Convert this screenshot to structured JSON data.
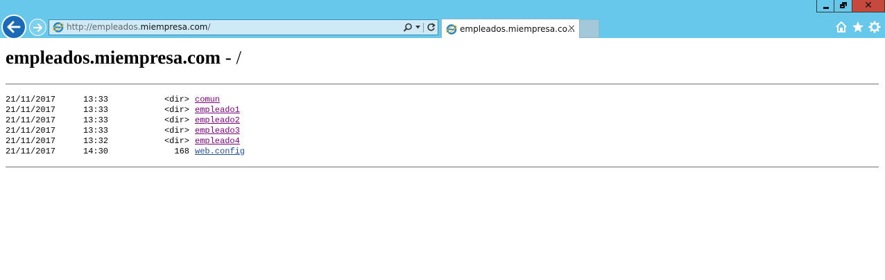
{
  "window_controls": {
    "minimize": "minimize",
    "maximize": "restore",
    "close": "✕"
  },
  "address_bar": {
    "url_prefix": "http://empleados.",
    "url_domain": "miempresa.com",
    "url_suffix": "/"
  },
  "tab": {
    "title": "empleados.miempresa.co...",
    "close": "×"
  },
  "page": {
    "title_host": "empleados.miempresa.com",
    "title_path": " - /"
  },
  "listing": [
    {
      "date": "21/11/2017",
      "time": "13:33",
      "info": "<dir>",
      "name": "comun",
      "visited": true
    },
    {
      "date": "21/11/2017",
      "time": "13:33",
      "info": "<dir>",
      "name": "empleado1",
      "visited": true
    },
    {
      "date": "21/11/2017",
      "time": "13:33",
      "info": "<dir>",
      "name": "empleado2",
      "visited": true
    },
    {
      "date": "21/11/2017",
      "time": "13:33",
      "info": "<dir>",
      "name": "empleado3",
      "visited": true
    },
    {
      "date": "21/11/2017",
      "time": "13:32",
      "info": "<dir>",
      "name": "empleado4",
      "visited": true
    },
    {
      "date": "21/11/2017",
      "time": "14:30",
      "info": "168",
      "name": "web.config",
      "visited": false
    }
  ],
  "colors": {
    "chrome": "#68c8eb",
    "visited_link": "#800080",
    "link": "#1f4e9c",
    "close_button": "#c7483d"
  }
}
